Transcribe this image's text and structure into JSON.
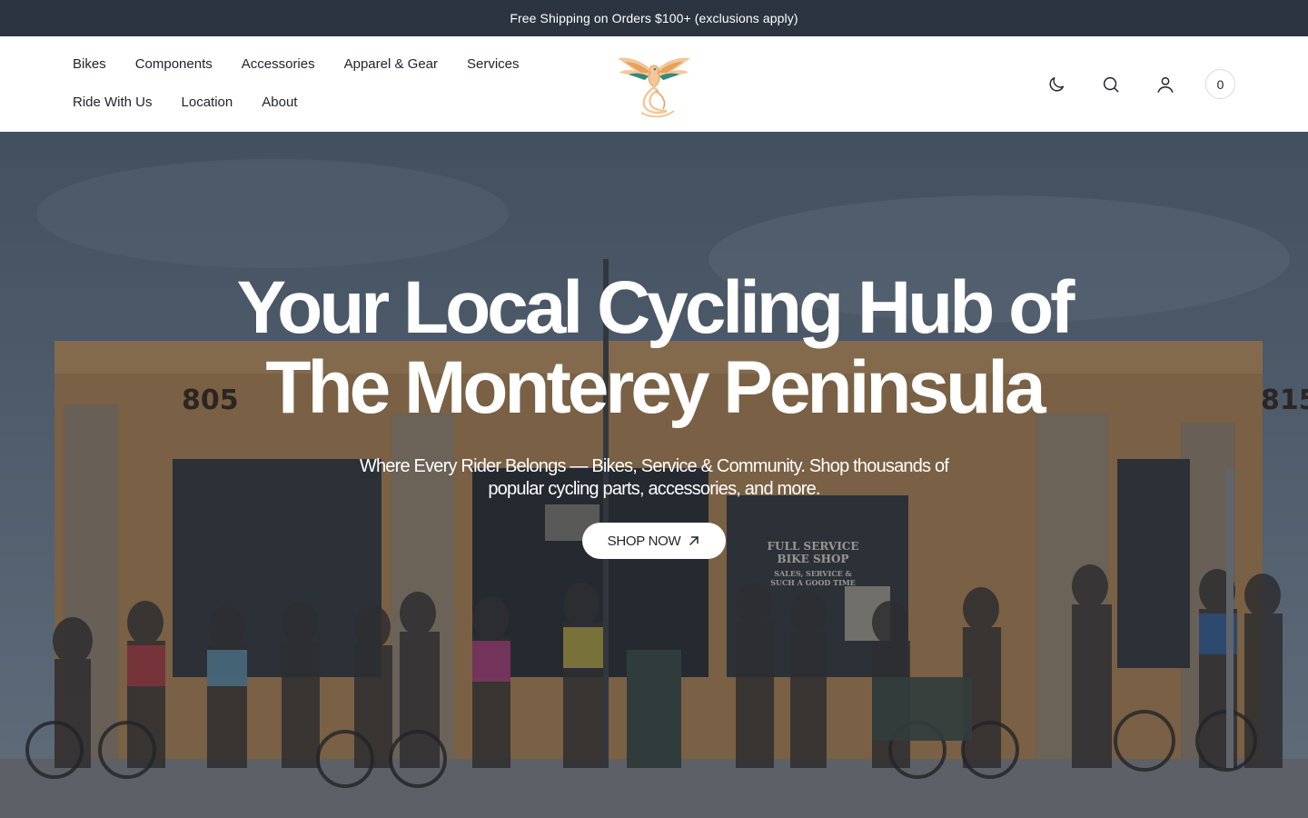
{
  "announcement": {
    "text": "Free Shipping on Orders $100+ (exclusions apply)"
  },
  "nav": {
    "row1": [
      "Bikes",
      "Components",
      "Accessories",
      "Apparel & Gear",
      "Services"
    ],
    "row2": [
      "Ride With Us",
      "Location",
      "About"
    ]
  },
  "header_icons": [
    "moon-icon",
    "search-icon",
    "user-icon"
  ],
  "cart": {
    "count": "0"
  },
  "hero": {
    "title_line1": "Your Local Cycling Hub of",
    "title_line2": "The Monterey Peninsula",
    "subtitle_line1": "Where Every Rider Belongs — Bikes, Service & Community. Shop thousands of",
    "subtitle_line2": "popular cycling parts, accessories, and more.",
    "cta_label": "SHOP NOW",
    "building_numbers": [
      "805",
      "815"
    ],
    "window_sign": [
      "FULL SERVICE",
      "BIKE SHOP",
      "SALES, SERVICE &",
      "SUCH A GOOD TIME"
    ]
  },
  "colors": {
    "announcement_bg": "#2c3440",
    "header_bg": "#ffffff",
    "accent_orange": "#e8a15a",
    "accent_teal": "#2f8a7d"
  }
}
